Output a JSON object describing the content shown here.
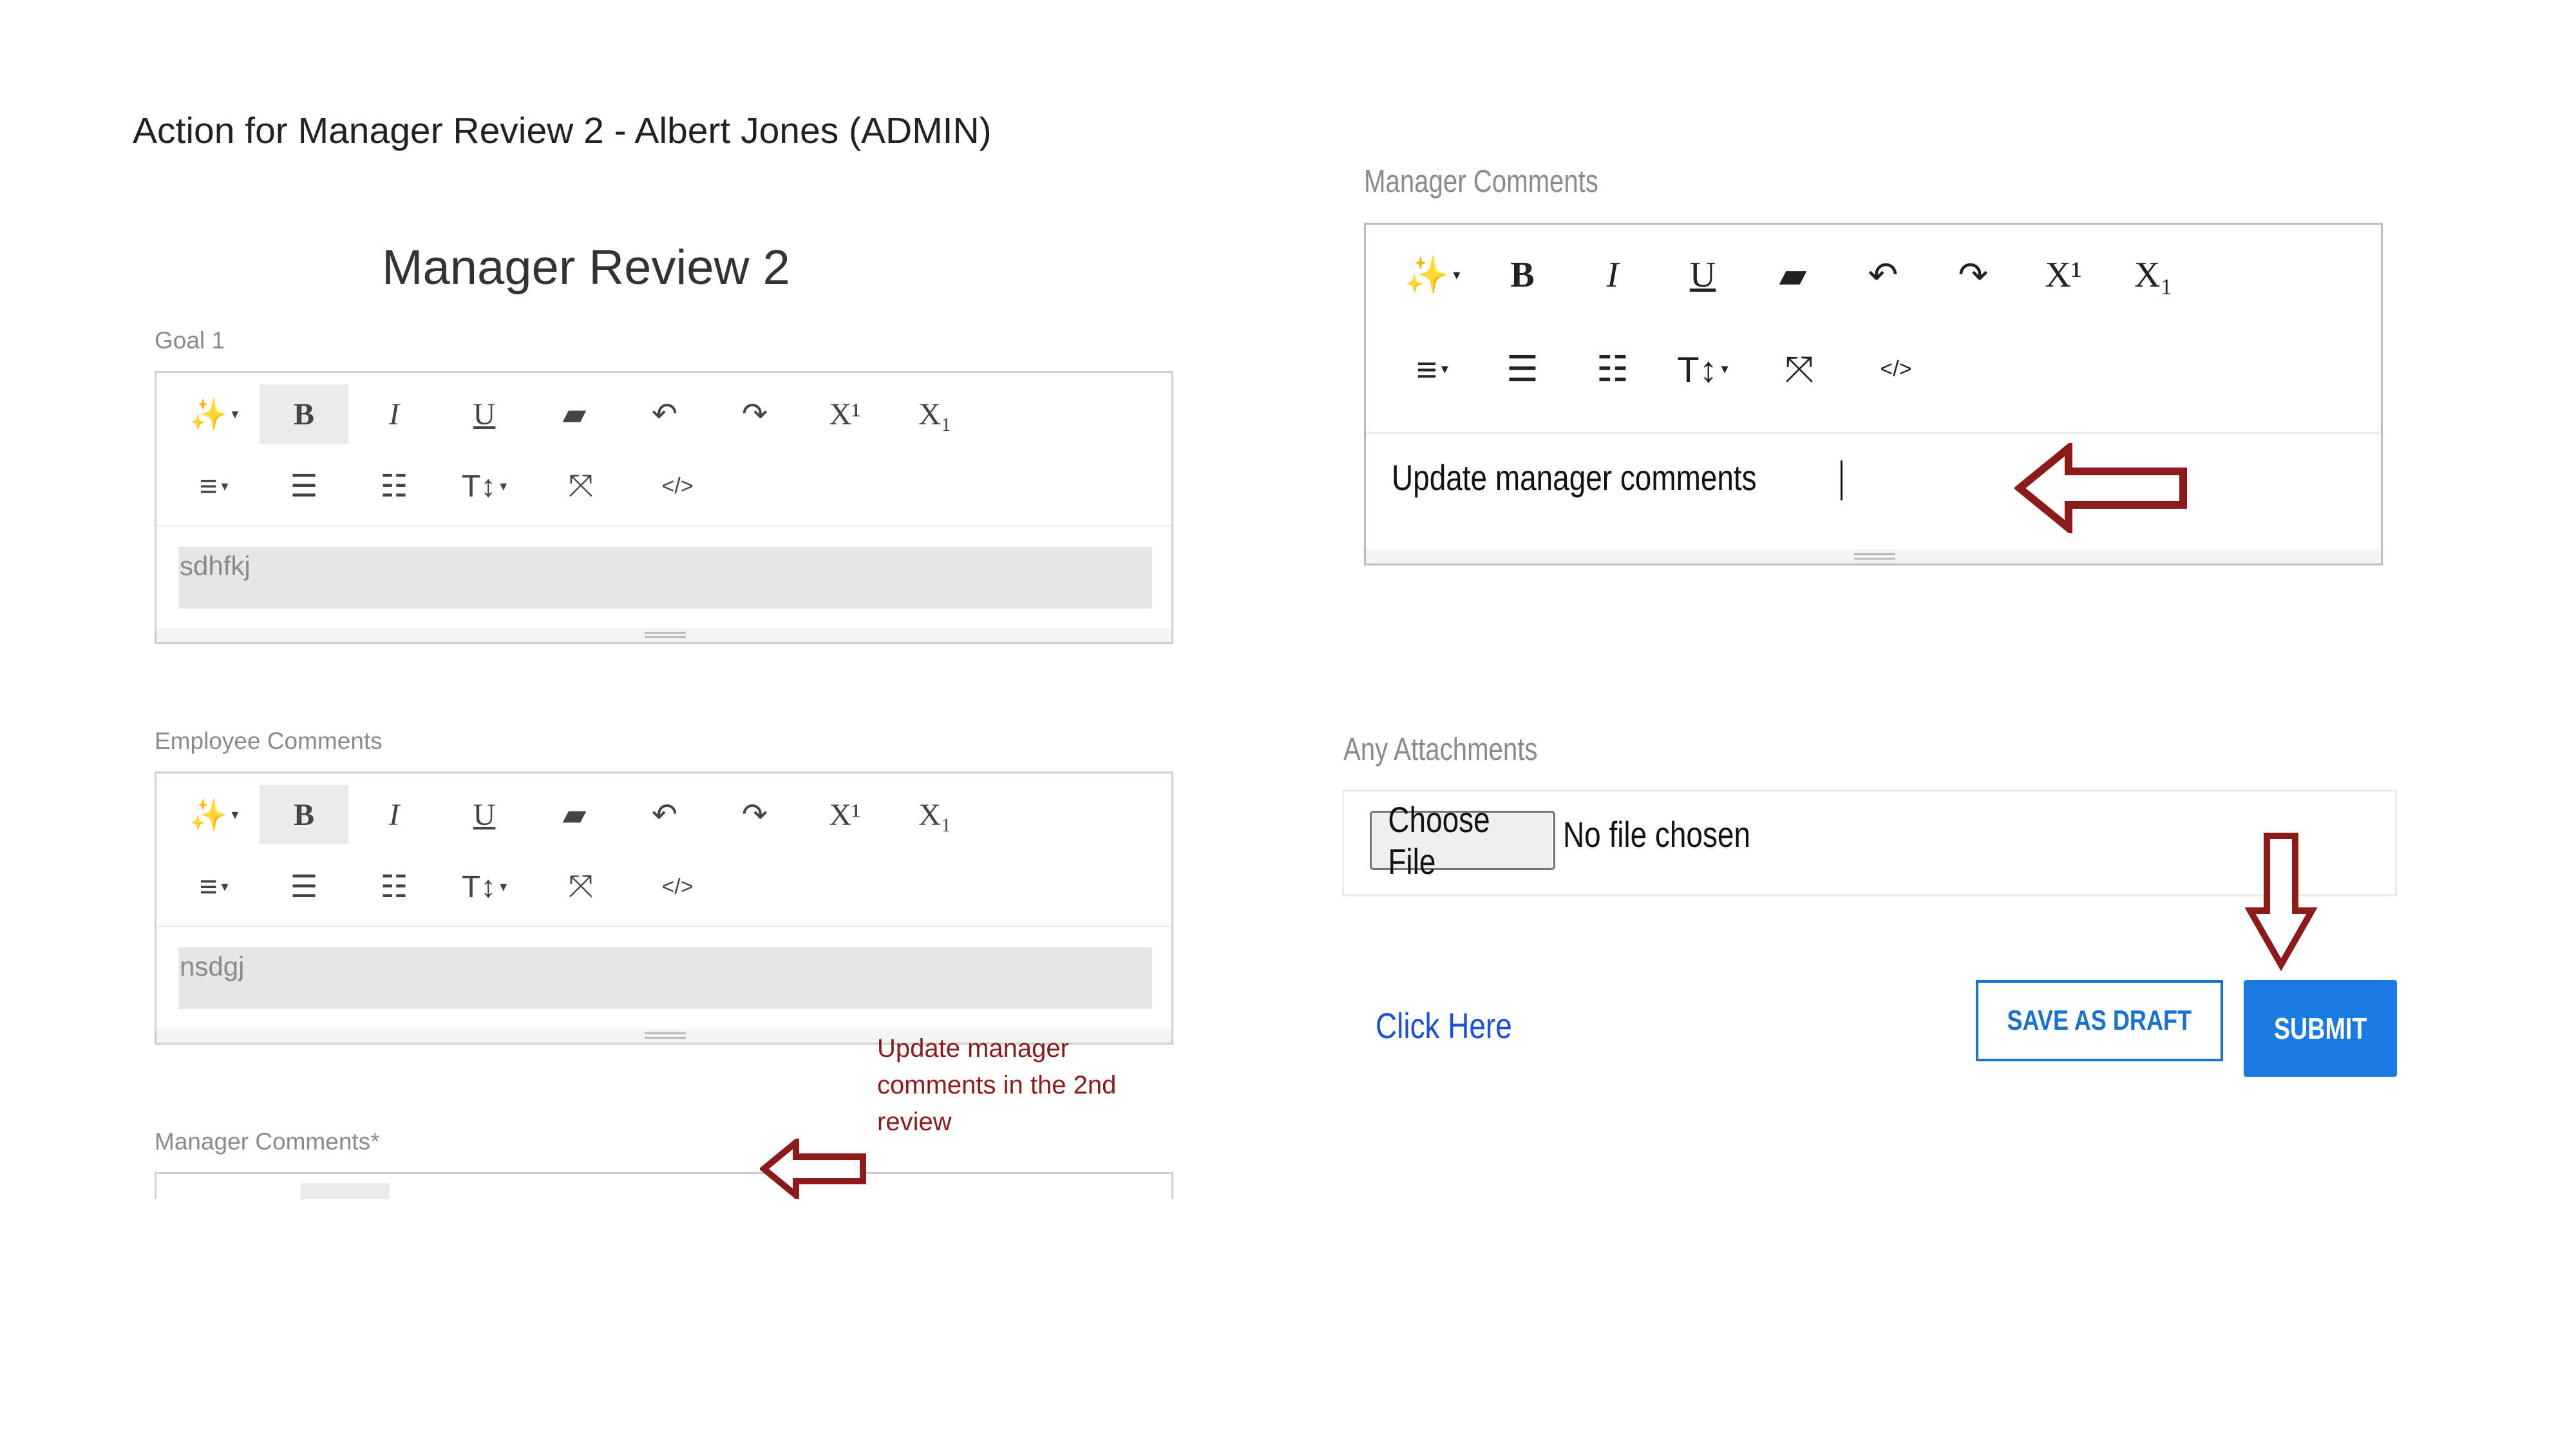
{
  "page": {
    "title": "Action for Manager Review 2 - Albert Jones (ADMIN)",
    "review_title": "Manager Review 2"
  },
  "colors": {
    "accent": "#1a7ae0",
    "annotation": "#8b1a1a",
    "link": "#1a4fd8"
  },
  "toolbar": {
    "row1": [
      {
        "icon": "magic-wand-icon",
        "glyph": "✨",
        "caret": true
      },
      {
        "icon": "bold-icon",
        "glyph": "B"
      },
      {
        "icon": "italic-icon",
        "glyph": "I"
      },
      {
        "icon": "underline-icon",
        "glyph": "U"
      },
      {
        "icon": "eraser-icon",
        "glyph": "▰"
      },
      {
        "icon": "undo-icon",
        "glyph": "↶"
      },
      {
        "icon": "redo-icon",
        "glyph": "↷"
      },
      {
        "icon": "superscript-icon",
        "glyph": "X¹"
      },
      {
        "icon": "subscript-icon",
        "glyph": "X₁"
      }
    ],
    "row2": [
      {
        "icon": "align-icon",
        "glyph": "≡",
        "caret": true
      },
      {
        "icon": "bullet-list-icon",
        "glyph": "☰"
      },
      {
        "icon": "numbered-list-icon",
        "glyph": "☷"
      },
      {
        "icon": "font-size-icon",
        "glyph": "T↕",
        "caret": true
      },
      {
        "icon": "fullscreen-icon",
        "glyph": "⤧"
      },
      {
        "icon": "code-view-icon",
        "glyph": "</>"
      }
    ]
  },
  "left": {
    "goal": {
      "label": "Goal 1",
      "content": "sdhfkj"
    },
    "employee_comments": {
      "label": "Employee Comments",
      "content": "nsdgj"
    },
    "manager_comments": {
      "label": "Manager Comments*"
    },
    "annotation": "Update manager comments in the 2nd review"
  },
  "right": {
    "manager_comments": {
      "label": "Manager Comments",
      "content": "Update manager comments"
    },
    "attachments": {
      "label": "Any Attachments",
      "choose_file": "Choose File",
      "no_file": "No file chosen"
    },
    "click_here": "Click Here",
    "save_draft": "SAVE AS DRAFT",
    "submit": "SUBMIT"
  }
}
